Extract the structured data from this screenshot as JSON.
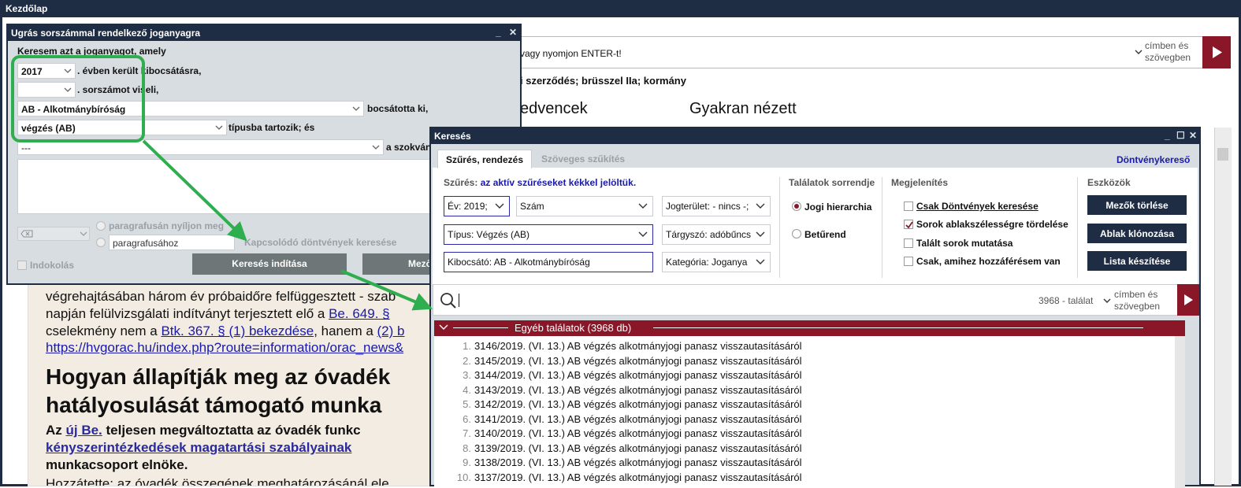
{
  "app": {
    "title": "Kezdőlap"
  },
  "bg": {
    "search_hint": "vagy nyomjon ENTER-t!",
    "scope_label_1": "címben és",
    "scope_label_2": "szövegben",
    "tags": "i szerződés; brüsszel IIa; kormány",
    "favorites": "edvencek",
    "frequent": "Gyakran nézett"
  },
  "article": {
    "l1a": "végrehajtásában három év próbaidőre felfüggesztett - szab",
    "l2a": "napján felülvizsgálati indítványt terjesztett elő a ",
    "l2b": "Be. 649. §",
    "l3a": "cselekmény nem a ",
    "l3b": "Btk. 367. § (1) bekezdése",
    "l3c": ", hanem a ",
    "l3d": "(2) b",
    "l4": "https://hvgorac.hu/index.php?route=information/orac_news&",
    "h1a": "Hogyan állapítják meg az óvadék",
    "h1b": "hatályosulását támogató munka",
    "p1a": "Az ",
    "p1b": "új Be.",
    "p1c": " teljesen megváltoztatta az óvadék funkc",
    "p2": "kényszerintézkedések magatartási szabályainak",
    "p3": "munkacsoport elnöke.",
    "p4": "Hozzátette: az óvadék összegének meghatározásánál ele"
  },
  "jump": {
    "title": "Ugrás sorszámmal rendelkező joganyagra",
    "intro": "Keresem azt a joganyagot, amely",
    "year_value": "2017",
    "year_label": ". évben került kibocsátásra,",
    "number_value": "",
    "number_label": ". sorszámot viseli,",
    "issuer_value": "AB - Alkotmánybíróság",
    "issuer_label": "bocsátotta ki,",
    "type_value": "végzés (AB)",
    "type_label": "típusba tartozik; és",
    "abbr_value": "---",
    "abbr_label": "a szokván",
    "opt_para": "paragrafusán nyíljon meg",
    "para_value": "paragrafusához",
    "connected_label": "Kapcsolódó döntvények keresése",
    "reasoning_label": "Indokolás",
    "search_button": "Keresés indítása",
    "fields_button": "Mező",
    "minimize": "_",
    "close": "✕"
  },
  "kereses": {
    "title": "Keresés",
    "tab_active": "Szűrés, rendezés",
    "tab_inactive": "Szöveges szűkítés",
    "donteny_link": "Döntvénykereső",
    "filter_note_label": "Szűrés:",
    "filter_note_text": "az aktív szűréseket kékkel jelöltük.",
    "year_filter": "Év: 2019;",
    "number_filter": "Szám",
    "area_filter": "Jogterület: - nincs -;",
    "type_filter": "Típus: Végzés (AB)",
    "keyword_filter": "Tárgyszó: adóbűncs",
    "issuer_filter": "Kibocsátó: AB - Alkotmánybíróság",
    "category_filter": "Kategória: Joganya",
    "sort_header": "Találatok sorrendje",
    "sort_hierarchy": "Jogi hierarchia",
    "sort_alpha": "Betűrend",
    "display_header": "Megjelenítés",
    "display_only_decisions": "Csak Döntvények keresése",
    "display_wrap": "Sorok ablakszélességre tördelése",
    "display_found_rows": "Talált sorok mutatása",
    "display_access": "Csak, amihez hozzáférésem van",
    "tools_header": "Eszközök",
    "btn_clear": "Mezők törlése",
    "btn_clone": "Ablak klónozása",
    "btn_list": "Lista készítése",
    "search_value": "",
    "hit_count": "3968 - találat",
    "scope_1": "címben és",
    "scope_2": "szövegben",
    "results_header": "Egyéb találatok (3968 db)",
    "minimize": "_",
    "maximize": "☐",
    "close": "✕"
  },
  "results": [
    {
      "n": "1.",
      "t": "3146/2019. (VI. 13.) AB végzés alkotmányjogi panasz visszautasításáról"
    },
    {
      "n": "2.",
      "t": "3145/2019. (VI. 13.) AB végzés alkotmányjogi panasz visszautasításáról"
    },
    {
      "n": "3.",
      "t": "3144/2019. (VI. 13.) AB végzés alkotmányjogi panasz visszautasításáról"
    },
    {
      "n": "4.",
      "t": "3143/2019. (VI. 13.) AB végzés alkotmányjogi panasz visszautasításáról"
    },
    {
      "n": "5.",
      "t": "3142/2019. (VI. 13.) AB végzés alkotmányjogi panasz visszautasításáról"
    },
    {
      "n": "6.",
      "t": "3141/2019. (VI. 13.) AB végzés alkotmányjogi panasz visszautasításáról"
    },
    {
      "n": "7.",
      "t": "3140/2019. (VI. 13.) AB végzés alkotmányjogi panasz visszautasításáról"
    },
    {
      "n": "8.",
      "t": "3139/2019. (VI. 13.) AB végzés alkotmányjogi panasz visszautasításáról"
    },
    {
      "n": "9.",
      "t": "3138/2019. (VI. 13.) AB végzés alkotmányjogi panasz visszautasításáról"
    },
    {
      "n": "10.",
      "t": "3137/2019. (VI. 13.) AB végzés alkotmányjogi panasz visszautasításáról"
    }
  ],
  "colors": {
    "accent": "#8a1728",
    "navy": "#1f2d44",
    "highlight": "#2eae4e",
    "link": "#1a1aaa"
  },
  "icons": [
    "chevron-down-icon",
    "play-icon",
    "search-icon",
    "close-icon",
    "minimize-icon",
    "maximize-icon",
    "check-icon",
    "clear-field-icon"
  ]
}
